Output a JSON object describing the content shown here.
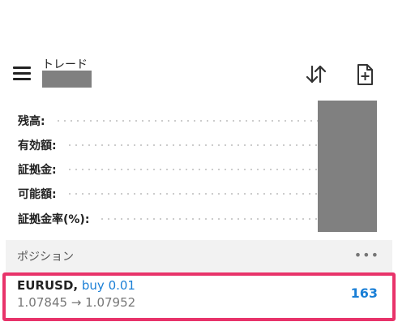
{
  "header": {
    "title": "トレード",
    "menu_icon": "hamburger-menu-icon",
    "sort_icon": "sort-arrows-icon",
    "new_order_icon": "new-order-document-icon"
  },
  "summary": {
    "rows": [
      {
        "label": "残高:"
      },
      {
        "label": "有効額:"
      },
      {
        "label": "証拠金:"
      },
      {
        "label": "可能額:"
      },
      {
        "label": "証拠金率(%):"
      }
    ]
  },
  "positions": {
    "section_title": "ポジション",
    "more_label": "•••",
    "items": [
      {
        "symbol": "EURUSD,",
        "side": "buy 0.01",
        "prices": "1.07845 → 1.07952",
        "profit": "163"
      }
    ]
  },
  "colors": {
    "accent_blue": "#1a7fd6",
    "highlight_border": "#e8336a",
    "redaction": "#808080",
    "section_bg": "#f2f2f2"
  }
}
